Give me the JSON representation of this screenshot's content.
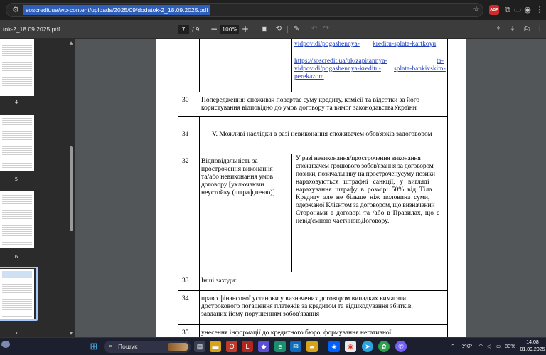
{
  "browser": {
    "url": "soscredit.ua/wp-content/uploads/2025/09/dodatok-2_18.09.2025.pdf",
    "icons": [
      "tune-icon",
      "star-icon",
      "adblock-icon",
      "extensions-icon",
      "sidebar-icon",
      "profile-icon",
      "menu-icon"
    ],
    "adblock_label": "ABP"
  },
  "pdf_toolbar": {
    "filename": "tok-2_18.09.2025.pdf",
    "current_page": "7",
    "page_separator": "/ 9",
    "zoom": "100%",
    "zoom_out": "−",
    "zoom_in": "+"
  },
  "thumbnails": [
    {
      "label": "4"
    },
    {
      "label": "5"
    },
    {
      "label": "6"
    },
    {
      "label": "7",
      "selected": true
    }
  ],
  "document": {
    "top_links": {
      "line1_a": "vidpovidi/pogashennya-",
      "line1_b": "kreditu-splata-kartkoyu",
      "line2_a": "https://soscredit.ua/uk/zapitannya-",
      "line2_b": "ta-",
      "line3_a": "vidpovidi/pogashennya-kreditu-",
      "line3_b": "splata-bankivskim-",
      "line4": "perekazom"
    },
    "rows": [
      {
        "num": "30",
        "lines": [
          "Попередження: споживач повертає суму кредиту, комісії та відсотки за його",
          "користування відповідно до умов договору та вимог законодавстваУкраїни"
        ]
      },
      {
        "num": "31",
        "heading": "V. Можливі наслідки в разі невиконання споживачем обов'язків задоговором"
      },
      {
        "num": "32",
        "left_lines": [
          "Відповідальність за",
          "прострочення виконання",
          "та/або невиконання умов",
          "договору [уключаючи",
          "неустойку (штраф,пеню)]"
        ],
        "right_lines": [
          "У разі невиконання/прострочення виконання",
          "споживачем грошового зобов'язання за договором",
          "позики, позичальнику на простроченусуму позики",
          "нараховуються штрафні санкції, у вигляді",
          "нарахування штрафу в розмірі 50% від Тіла",
          "Кредиту але не більше ніж половина суми,",
          "одержаної Клієнтом за договором, що визначений",
          "Сторонами в договорі та /або в Правилах, що є",
          "невід'ємною частиноюДоговору."
        ]
      },
      {
        "num": "33",
        "lines": [
          "Інші заходи:"
        ]
      },
      {
        "num": "34",
        "lines": [
          "право фінансової установи у визначених договором випадках вимагати",
          "дострокового погашення платежів за кредитом та відшкодування збитків,",
          "завданих йому порушенням зобов'язання"
        ]
      },
      {
        "num": "35",
        "lines": [
          "унесення інформації до кредитного бюро, формування негативної"
        ]
      }
    ]
  },
  "taskbar": {
    "search_placeholder": "Пошук",
    "apps": [
      "start-icon",
      "task-view-icon",
      "file-explorer-icon",
      "store-icon",
      "opera-icon",
      "app-l-icon",
      "copilot-icon",
      "edge-icon",
      "mail-icon",
      "folder-icon",
      "dropbox-icon",
      "chrome-icon",
      "telegram-icon",
      "app-green-icon",
      "viber-icon"
    ],
    "tray": {
      "language": "УКР",
      "battery": "83%",
      "time": "14:08",
      "date": "01.09.2025"
    },
    "colors": {
      "taskbar": "#1c1f2e",
      "chrome_blue": "#2f5fb8"
    }
  }
}
